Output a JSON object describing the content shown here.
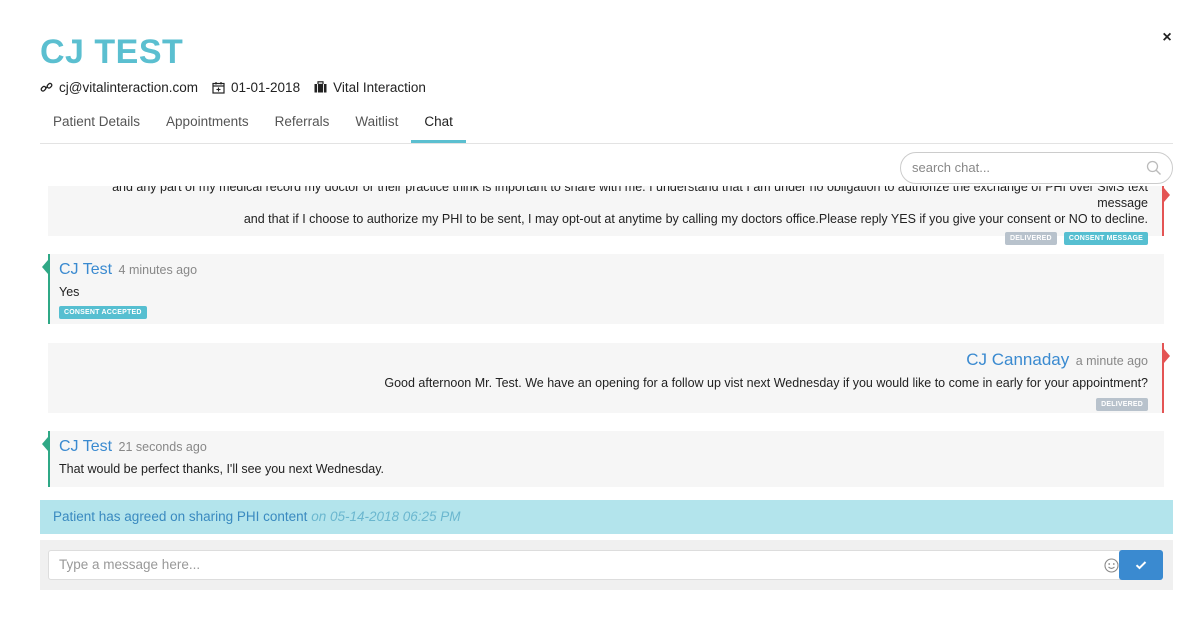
{
  "header": {
    "title": "CJ TEST",
    "close_icon": "×",
    "email": "cj@vitalinteraction.com",
    "dob": "01-01-2018",
    "organization": "Vital Interaction"
  },
  "tabs": [
    {
      "label": "Patient Details"
    },
    {
      "label": "Appointments"
    },
    {
      "label": "Referrals"
    },
    {
      "label": "Waitlist"
    },
    {
      "label": "Chat",
      "active": true
    }
  ],
  "search": {
    "placeholder": "search chat..."
  },
  "messages": [
    {
      "direction": "out",
      "text_line1": "and any part of my medical record my doctor or their practice think is important to share with me. I understand that I am under no obligation to authorize the exchange of PHI over SMS text message",
      "text_line2": "and that if I choose to authorize my PHI to be sent, I may opt-out at anytime by calling my doctors office.Please reply YES if you give your consent or NO to decline.",
      "badges": [
        "DELIVERED",
        "CONSENT MESSAGE"
      ]
    },
    {
      "direction": "in",
      "sender": "CJ Test",
      "time": "4 minutes ago",
      "text": "Yes",
      "badges": [
        "CONSENT ACCEPTED"
      ]
    },
    {
      "direction": "out",
      "sender": "CJ Cannaday",
      "time": "a minute ago",
      "text": "Good afternoon Mr. Test. We have an opening for a follow up vist next Wednesday if you would like to come in early for your appointment?",
      "badges": [
        "DELIVERED"
      ]
    },
    {
      "direction": "in",
      "sender": "CJ Test",
      "time": "21 seconds ago",
      "text": "That would be perfect thanks, I'll see you next Wednesday."
    }
  ],
  "agreement": {
    "text": "Patient has agreed on sharing PHI content",
    "date": "on 05-14-2018 06:25 PM"
  },
  "composer": {
    "placeholder": "Type a message here..."
  },
  "colors": {
    "accent": "#5bbfd0",
    "sender_name": "#3a8ad0",
    "incoming_marker": "#2fa886",
    "outgoing_marker": "#e45454",
    "agreement_bg": "#b3e4ec",
    "send_button": "#3a8ad0"
  },
  "icons": [
    "link-icon",
    "calendar-icon",
    "briefcase-icon",
    "search-icon",
    "emoji-icon",
    "check-icon",
    "close-icon"
  ]
}
